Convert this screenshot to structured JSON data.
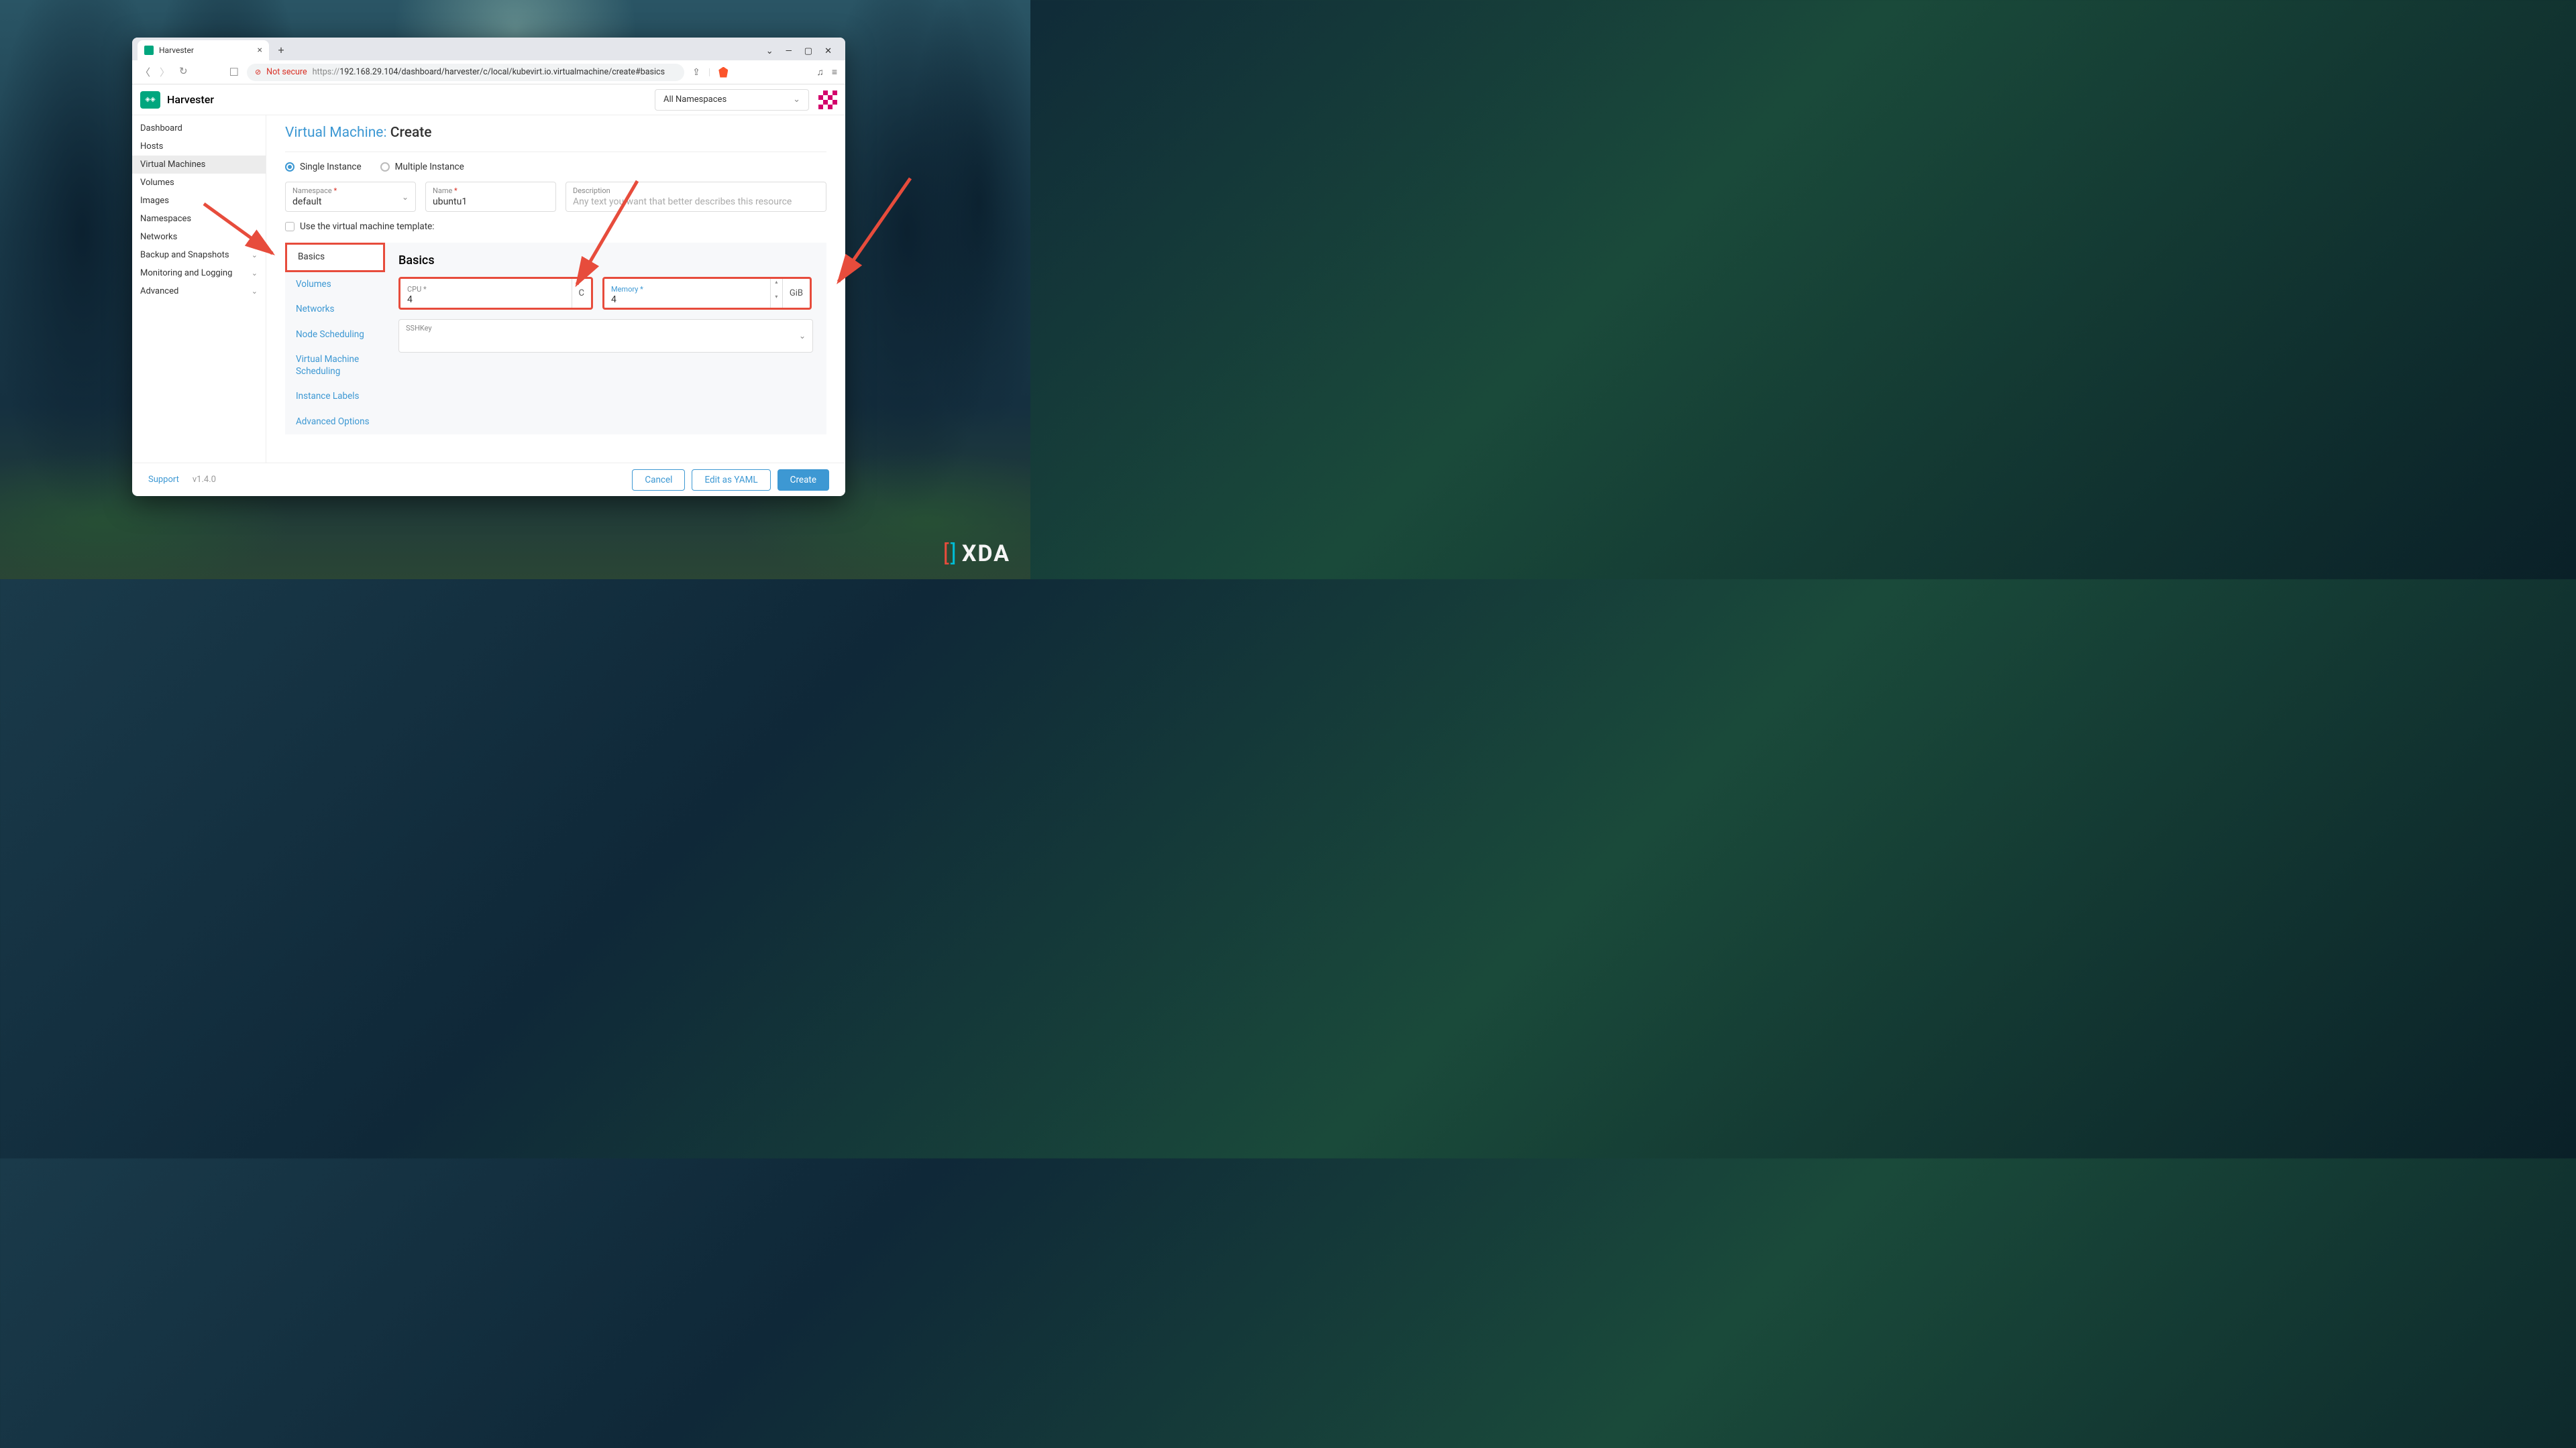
{
  "browser": {
    "tab_title": "Harvester",
    "not_secure_label": "Not secure",
    "url_protocol": "https://",
    "url_rest": "192.168.29.104/dashboard/harvester/c/local/kubevirt.io.virtualmachine/create#basics"
  },
  "app": {
    "name": "Harvester",
    "namespace_selector": "All Namespaces"
  },
  "sidebar": {
    "items": [
      {
        "label": "Dashboard",
        "expandable": false
      },
      {
        "label": "Hosts",
        "expandable": false
      },
      {
        "label": "Virtual Machines",
        "expandable": false,
        "active": true
      },
      {
        "label": "Volumes",
        "expandable": false
      },
      {
        "label": "Images",
        "expandable": false
      },
      {
        "label": "Namespaces",
        "expandable": false
      },
      {
        "label": "Networks",
        "expandable": true
      },
      {
        "label": "Backup and Snapshots",
        "expandable": true
      },
      {
        "label": "Monitoring and Logging",
        "expandable": true
      },
      {
        "label": "Advanced",
        "expandable": true
      }
    ]
  },
  "page": {
    "title_crumb": "Virtual Machine:",
    "title_leaf": "Create",
    "radio_single": "Single Instance",
    "radio_multiple": "Multiple Instance",
    "namespace_label": "Namespace",
    "namespace_value": "default",
    "name_label": "Name",
    "name_value": "ubuntu1",
    "description_label": "Description",
    "description_placeholder": "Any text you want that better describes this resource",
    "template_checkbox_label": "Use the virtual machine template:"
  },
  "config_nav": {
    "basics": "Basics",
    "volumes": "Volumes",
    "networks": "Networks",
    "node_scheduling": "Node Scheduling",
    "vm_scheduling": "Virtual Machine Scheduling",
    "instance_labels": "Instance Labels",
    "advanced_options": "Advanced Options"
  },
  "basics": {
    "panel_title": "Basics",
    "cpu_label": "CPU",
    "cpu_value": "4",
    "cpu_unit": "C",
    "memory_label": "Memory",
    "memory_value": "4",
    "memory_unit": "GiB",
    "sshkey_label": "SSHKey"
  },
  "footer": {
    "support": "Support",
    "version": "v1.4.0",
    "cancel": "Cancel",
    "edit_yaml": "Edit as YAML",
    "create": "Create"
  },
  "watermark": "XDA"
}
